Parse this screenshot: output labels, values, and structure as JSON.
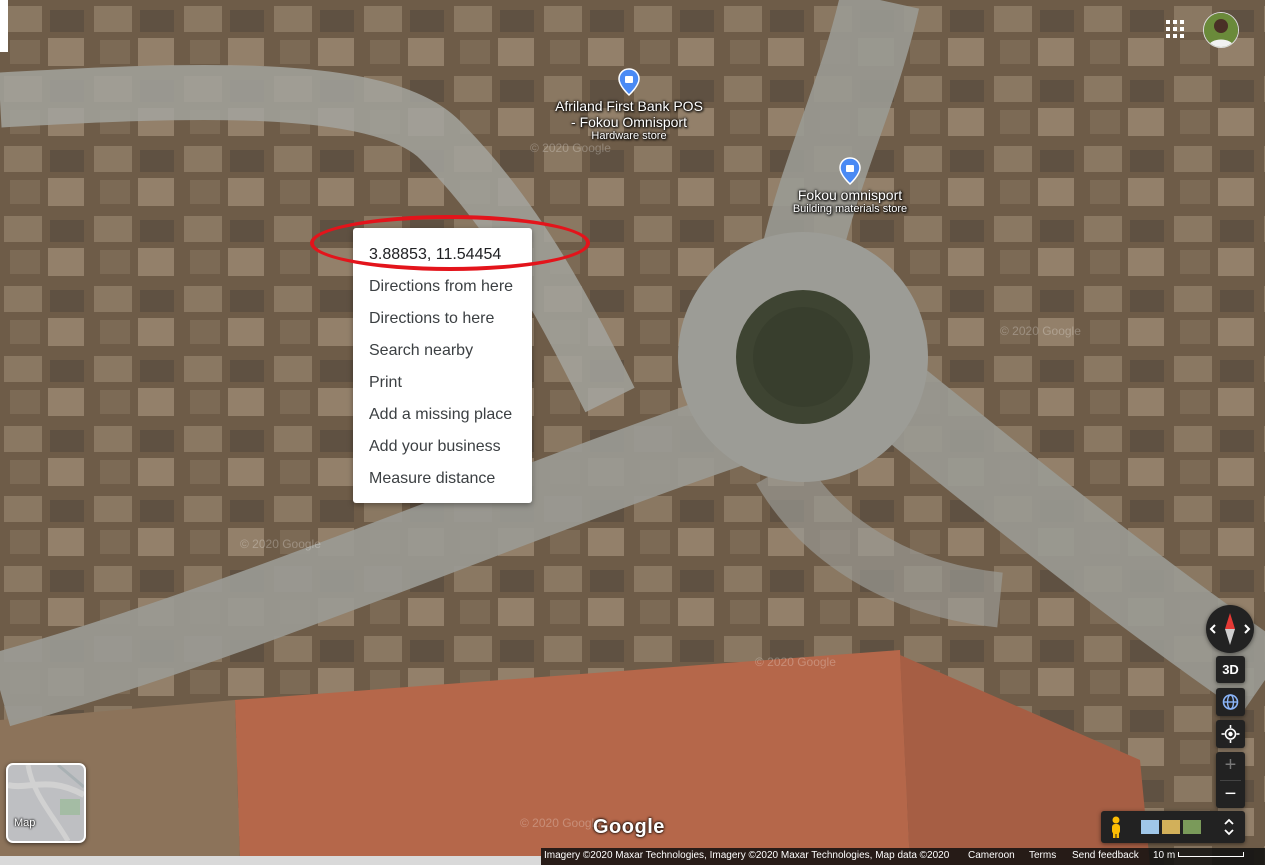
{
  "context_menu": {
    "coordinates": "3.88853, 11.54454",
    "items": [
      "Directions from here",
      "Directions to here",
      "Search nearby",
      "Print",
      "Add a missing place",
      "Add your business",
      "Measure distance"
    ]
  },
  "places": [
    {
      "name": "Afriland First Bank POS\n- Fokou Omnisport",
      "category": "Hardware store"
    },
    {
      "name": "Fokou omnisport",
      "category": "Building materials store"
    }
  ],
  "controls": {
    "three_d": "3D",
    "zoom_in": "+",
    "zoom_out": "−",
    "layer_label": "Map"
  },
  "branding": {
    "logo": "Google"
  },
  "watermark": "© 2020 Google",
  "footer": {
    "attribution": "Imagery ©2020 Maxar Technologies, Imagery ©2020 Maxar Technologies, Map data ©2020",
    "country": "Cameroon",
    "terms": "Terms",
    "feedback": "Send feedback",
    "scale": "10 m"
  },
  "colors": {
    "highlight_ring": "#e3141b",
    "pin": "#4a8af4",
    "soil": "#b5674a",
    "road": "#9a9a94"
  },
  "icons": [
    "apps-grid-icon",
    "place-pin-icon",
    "compass-icon",
    "globe-icon",
    "my-location-icon",
    "pegman-icon",
    "layers-icon"
  ]
}
